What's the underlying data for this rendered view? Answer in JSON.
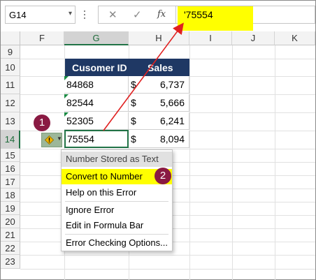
{
  "formula_bar": {
    "name_box": "G14",
    "cancel_icon": "x-icon",
    "enter_icon": "checkmark-icon",
    "fx_label": "fx",
    "formula_value": "'75554"
  },
  "columns": [
    "F",
    "G",
    "H",
    "I",
    "J",
    "K"
  ],
  "rows": [
    "9",
    "10",
    "11",
    "12",
    "13",
    "14",
    "15",
    "16",
    "17",
    "18",
    "19",
    "20",
    "21",
    "22",
    "23"
  ],
  "table": {
    "headers": [
      "Cusomer ID",
      "Sales"
    ],
    "rows": [
      {
        "id": "84868",
        "currency": "$",
        "amount": "6,737"
      },
      {
        "id": "82544",
        "currency": "$",
        "amount": "5,666"
      },
      {
        "id": "52305",
        "currency": "$",
        "amount": "6,241"
      },
      {
        "id": "75554",
        "currency": "$",
        "amount": "8,094"
      }
    ]
  },
  "error_menu": {
    "header": "Number Stored as Text",
    "items": [
      "Convert to Number",
      "Help on this Error",
      "Ignore Error",
      "Edit in Formula Bar",
      "Error Checking Options..."
    ]
  },
  "badges": [
    "1",
    "2"
  ],
  "colors": {
    "table_header": "#1f3864",
    "highlight": "#ffff00",
    "badge": "#8a1a43",
    "arrow": "#e02020",
    "selection": "#217346"
  }
}
